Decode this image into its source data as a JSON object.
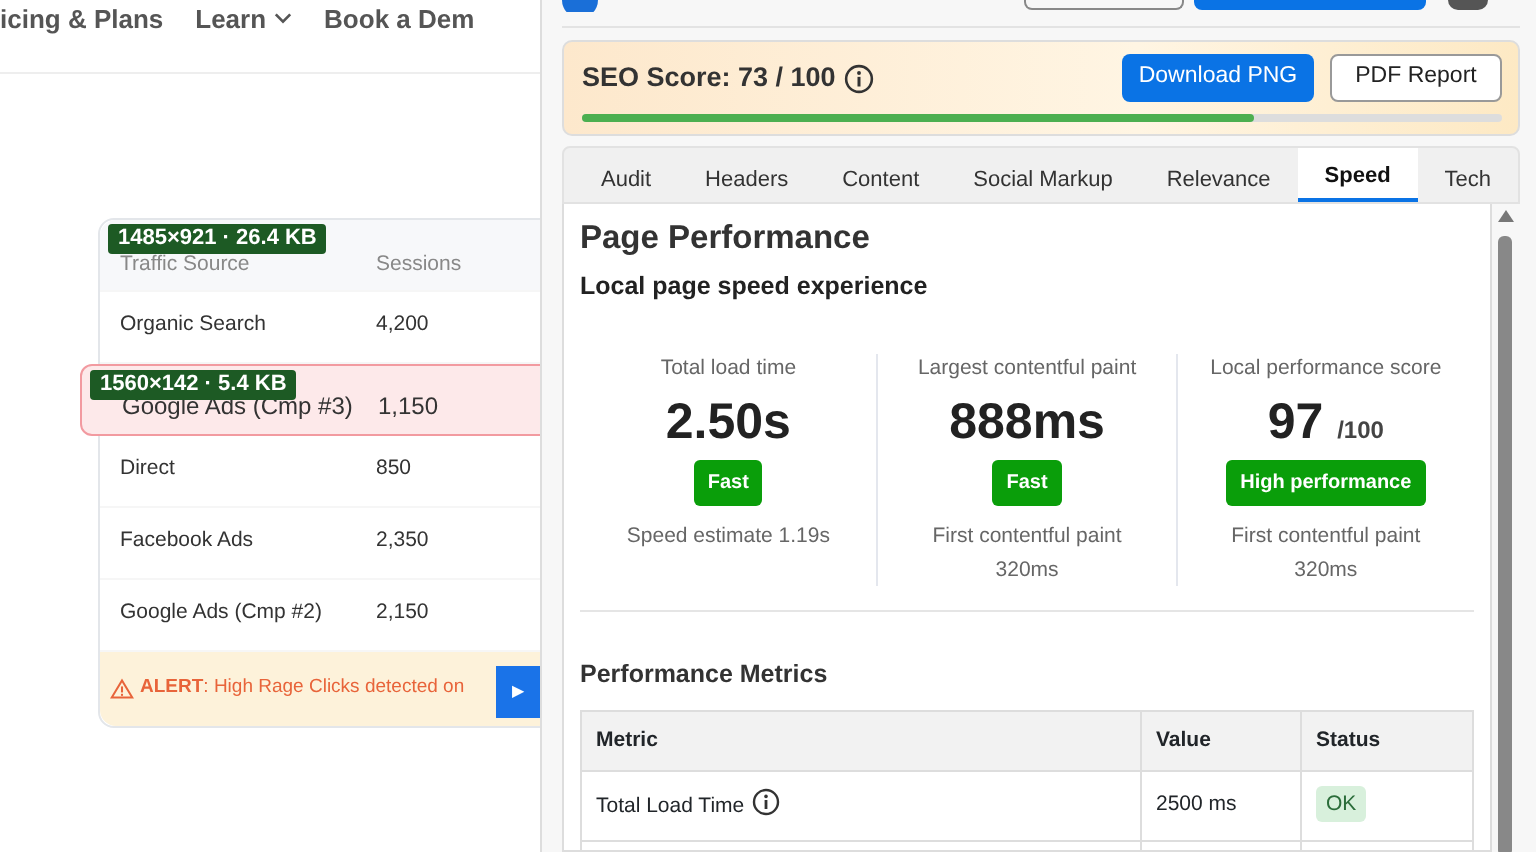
{
  "background_page": {
    "nav": [
      {
        "label": "icing & Plans",
        "has_menu": false
      },
      {
        "label": "Learn",
        "has_menu": true
      },
      {
        "label": "Book a Dem",
        "has_menu": false
      }
    ],
    "table": {
      "size_label": "1485×921 · 26.4 KB",
      "columns": [
        "Traffic Source",
        "Sessions"
      ],
      "rows": [
        {
          "cells": [
            "Organic Search",
            "4,200"
          ],
          "highlighted": false
        },
        {
          "cells": [
            "Google Ads (Cmp #3)",
            "1,150"
          ],
          "highlighted": true,
          "size_label": "1560×142 · 5.4 KB"
        },
        {
          "cells": [
            "Direct",
            "850"
          ],
          "highlighted": false
        },
        {
          "cells": [
            "Facebook Ads",
            "2,350"
          ],
          "highlighted": false
        },
        {
          "cells": [
            "Google Ads (Cmp #2)",
            "2,150"
          ],
          "highlighted": false
        }
      ],
      "alert": "**ALERT**: High Rage Clicks detected on",
      "play_button": "▶"
    }
  },
  "panel": {
    "seo": {
      "label": "SEO Score: 73 / 100",
      "level": 0.73,
      "buttons": [
        {
          "label": "Download PNG",
          "primary": true
        },
        {
          "label": "PDF Report",
          "primary": false
        }
      ]
    },
    "tabs": [
      {
        "label": "Audit",
        "selected": false
      },
      {
        "label": "Headers",
        "selected": false
      },
      {
        "label": "Content",
        "selected": false
      },
      {
        "label": "Social Markup",
        "selected": false
      },
      {
        "label": "Relevance",
        "selected": false
      },
      {
        "label": "Speed",
        "selected": true
      },
      {
        "label": "Tech",
        "selected": false
      }
    ],
    "speed": {
      "title": "Page Performance",
      "subtitle": "Local page speed experience",
      "metrics": [
        {
          "label": "Total load time",
          "value": "2.50s",
          "badge": "Fast",
          "notes": [
            "Speed estimate 1.19s"
          ]
        },
        {
          "label": "Largest contentful paint",
          "value": "888ms",
          "badge": "Fast",
          "notes": [
            "First contentful paint",
            "320ms"
          ]
        },
        {
          "label": "Local performance score",
          "value": "97",
          "unit": "/100",
          "badge": "High performance",
          "notes": [
            "First contentful paint",
            "320ms"
          ]
        }
      ],
      "metrics_table": {
        "title": "Performance Metrics",
        "columns": [
          "Metric",
          "Value",
          "Status"
        ],
        "rows": [
          {
            "metric": "Total Load Time",
            "value": "2500 ms",
            "status": "OK"
          }
        ]
      }
    }
  }
}
